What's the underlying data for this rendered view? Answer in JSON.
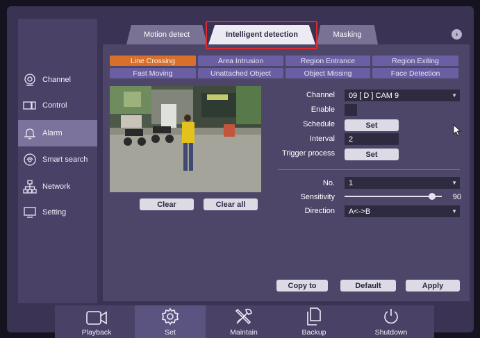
{
  "sidebar": {
    "items": [
      {
        "label": "Channel",
        "icon": "camera-lens-icon"
      },
      {
        "label": "Control",
        "icon": "ptz-camera-icon"
      },
      {
        "label": "Alarm",
        "icon": "bell-icon",
        "active": true
      },
      {
        "label": "Smart search",
        "icon": "smart-search-icon"
      },
      {
        "label": "Network",
        "icon": "network-icon"
      },
      {
        "label": "Setting",
        "icon": "monitor-icon"
      }
    ]
  },
  "tabs": [
    {
      "label": "Motion detect"
    },
    {
      "label": "Intelligent detection",
      "active": true
    },
    {
      "label": "Masking"
    }
  ],
  "tab_next_label": "›",
  "subtabs": [
    {
      "label": "Line Crossing",
      "active": true
    },
    {
      "label": "Area Intrusion"
    },
    {
      "label": "Region Entrance"
    },
    {
      "label": "Region Exiting"
    },
    {
      "label": "Fast Moving"
    },
    {
      "label": "Unattached Object"
    },
    {
      "label": "Object Missing"
    },
    {
      "label": "Face Detection"
    }
  ],
  "preview": {
    "clear_label": "Clear",
    "clear_all_label": "Clear all"
  },
  "form": {
    "channel_label": "Channel",
    "channel_value": "09 [ D ] CAM 9",
    "enable_label": "Enable",
    "schedule_label": "Schedule",
    "schedule_button": "Set",
    "interval_label": "Interval",
    "interval_value": "2",
    "trigger_label": "Trigger process",
    "trigger_button": "Set",
    "no_label": "No.",
    "no_value": "1",
    "sensitivity_label": "Sensitivity",
    "sensitivity_value": "90",
    "sensitivity_fraction": 0.9,
    "direction_label": "Direction",
    "direction_value": "A<->B"
  },
  "actions": {
    "copy_to": "Copy to",
    "default": "Default",
    "apply": "Apply"
  },
  "dock": [
    {
      "label": "Playback",
      "icon": "playback-camera-icon"
    },
    {
      "label": "Set",
      "icon": "gear-icon",
      "active": true
    },
    {
      "label": "Maintain",
      "icon": "tools-icon"
    },
    {
      "label": "Backup",
      "icon": "backup-copy-icon"
    },
    {
      "label": "Shutdown",
      "icon": "power-icon"
    }
  ],
  "colors": {
    "active_subtab": "#d86f2a",
    "subtab": "#6a5fa3",
    "highlight_box": "#e0282e",
    "panel": "#4e4669"
  }
}
